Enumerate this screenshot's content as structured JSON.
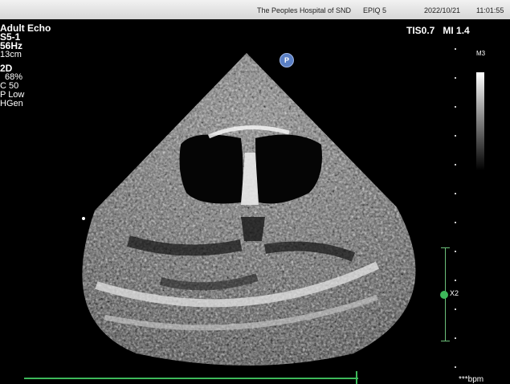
{
  "header": {
    "hospital": "The Peoples Hospital of SND",
    "model": "EPIQ 5",
    "date": "2022/10/21",
    "time": "11:01:55"
  },
  "left_panel": {
    "preset": "Adult Echo",
    "probe": "S5-1",
    "frequency": "56Hz",
    "depth": "13cm",
    "mode": "2D",
    "gain": "68%",
    "compression": "C 50",
    "persistence": "P Low",
    "harmonic": "HGen"
  },
  "indices": {
    "tis": "TIS0.7",
    "mi": "MI 1.4"
  },
  "grayscale_map": "M3",
  "probe_marker": "P",
  "caliper_label": "X2",
  "heart_rate": "***bpm",
  "colors": {
    "ecg": "#3db85a",
    "marker": "#5a7fc4"
  }
}
